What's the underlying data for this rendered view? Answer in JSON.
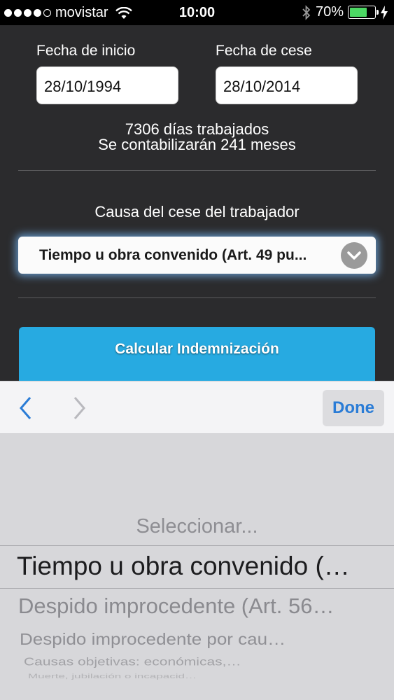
{
  "status_bar": {
    "carrier": "movistar",
    "time": "10:00",
    "battery": "70%",
    "battery_level": 0.7,
    "signal_bars": 4
  },
  "form": {
    "start_date_label": "Fecha de inicio",
    "start_date_value": "28/10/1994",
    "end_date_label": "Fecha de cese",
    "end_date_value": "28/10/2014",
    "days_worked": "7306 días trabajados",
    "months_counted": "Se contabilizarán 241 meses",
    "cause_label": "Causa del cese del trabajador",
    "cause_selected": "Tiempo u obra convenido (Art. 49 pu...",
    "calculate_button": "Calcular Indemnización"
  },
  "toolbar": {
    "done_label": "Done"
  },
  "picker": {
    "options": [
      "Seleccionar...",
      "Tiempo u obra convenido (…",
      "Despido improcedente (Art. 56…",
      "Despido improcedente por cau…",
      "Causas objetivas: económicas,…",
      "Muerte, jubilación o incapacid…"
    ]
  },
  "colors": {
    "background": "#2b2b2d",
    "accent_button": "#27aae1",
    "done_text": "#2a7cd6",
    "battery_fill": "#4cd964"
  }
}
